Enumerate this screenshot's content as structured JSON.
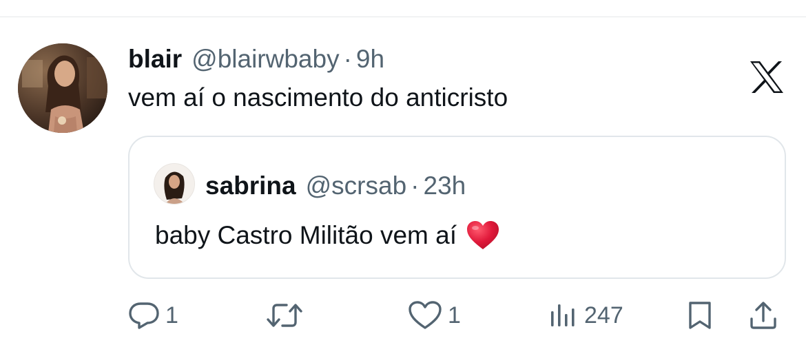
{
  "tweet": {
    "author": {
      "display_name": "blair",
      "handle": "@blairwbaby",
      "separator": "·",
      "time": "9h"
    },
    "text": "vem aí o nascimento do anticristo",
    "brand_icon": "x-logo-icon",
    "quoted": {
      "display_name": "sabrina",
      "handle": "@scrsab",
      "separator": "·",
      "time": "23h",
      "text": "baby Castro Militão vem aí",
      "emoji": "heart-emoji"
    },
    "actions": {
      "reply_count": "1",
      "like_count": "1",
      "views_count": "247"
    }
  },
  "colors": {
    "text_primary": "#0f1419",
    "text_secondary": "#536471",
    "border": "#e1e6ea",
    "heart": "#e0193a"
  }
}
